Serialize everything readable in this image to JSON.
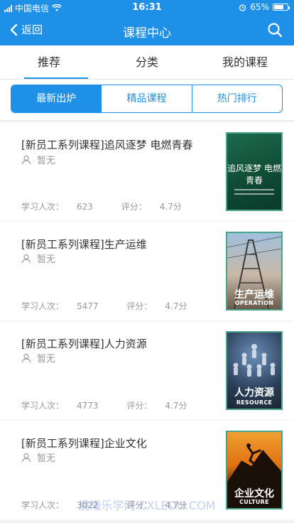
{
  "status": {
    "carrier": "中国电信",
    "time": "16:31",
    "battery": "65%"
  },
  "nav": {
    "back_label": "返回",
    "title": "课程中心"
  },
  "tabs": [
    {
      "label": "推荐",
      "active": true
    },
    {
      "label": "分类",
      "active": false
    },
    {
      "label": "我的课程",
      "active": false
    }
  ],
  "segments": [
    {
      "label": "最新出炉",
      "active": true
    },
    {
      "label": "精品课程",
      "active": false
    },
    {
      "label": "热门排行",
      "active": false
    }
  ],
  "courses": [
    {
      "title": "[新员工系列课程]追风逐梦 电燃青春",
      "author": "暂无",
      "learners_label": "学习人次：",
      "learners": "623",
      "rating_label": "评分：",
      "rating": "4.7分",
      "thumb_text": "追风逐梦 电燃青春"
    },
    {
      "title": "[新员工系列课程]生产运维",
      "author": "暂无",
      "learners_label": "学习人次：",
      "learners": "5477",
      "rating_label": "评分：",
      "rating": "4.7分",
      "thumb_text": "生产运维",
      "thumb_sub": "OPERATION"
    },
    {
      "title": "[新员工系列课程]人力资源",
      "author": "暂无",
      "learners_label": "学习人次：",
      "learners": "4773",
      "rating_label": "评分：",
      "rating": "4.7分",
      "thumb_text": "人力资源",
      "thumb_sub": "RESOURCE"
    },
    {
      "title": "[新员工系列课程]企业文化",
      "author": "暂无",
      "learners_label": "学习人次：",
      "learners": "3022",
      "rating_label": "评分：",
      "rating": "4.7分",
      "thumb_text": "企业文化",
      "thumb_sub": "CULTURE"
    }
  ],
  "watermark": "晨曦乐学网 CXLEDU.COM",
  "colors": {
    "accent": "#1e90e8",
    "thumb_border": "#4aa48a"
  }
}
